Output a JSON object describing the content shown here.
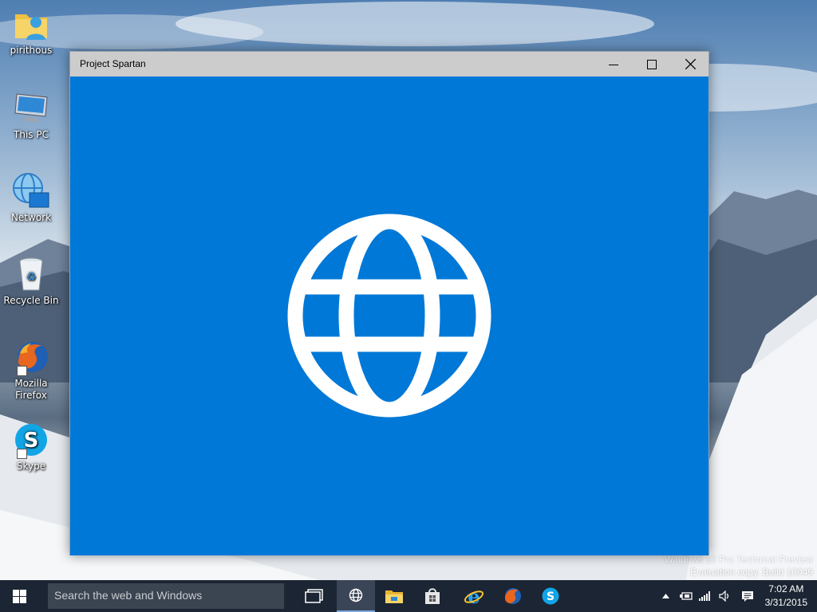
{
  "desktop": {
    "icons": [
      {
        "label": "pirithous",
        "icon": "user-folder-icon"
      },
      {
        "label": "This PC",
        "icon": "computer-icon"
      },
      {
        "label": "Network",
        "icon": "network-icon"
      },
      {
        "label": "Recycle Bin",
        "icon": "recycle-bin-icon"
      },
      {
        "label": "Mozilla Firefox",
        "icon": "firefox-icon"
      },
      {
        "label": "Skype",
        "icon": "skype-icon"
      }
    ],
    "watermark": {
      "line1": "Windows 10 Pro Technical Preview",
      "line2": "Evaluation copy. Build 10049"
    }
  },
  "window": {
    "title": "Project Spartan",
    "splash_icon": "globe-icon",
    "accent_color": "#0078d7"
  },
  "taskbar": {
    "search_placeholder": "Search the web and Windows",
    "apps": [
      "task-view-icon",
      "spartan-icon",
      "file-explorer-icon",
      "store-icon",
      "internet-explorer-icon",
      "firefox-icon",
      "skype-icon"
    ],
    "clock": {
      "time": "7:02 AM",
      "date": "3/31/2015"
    }
  }
}
